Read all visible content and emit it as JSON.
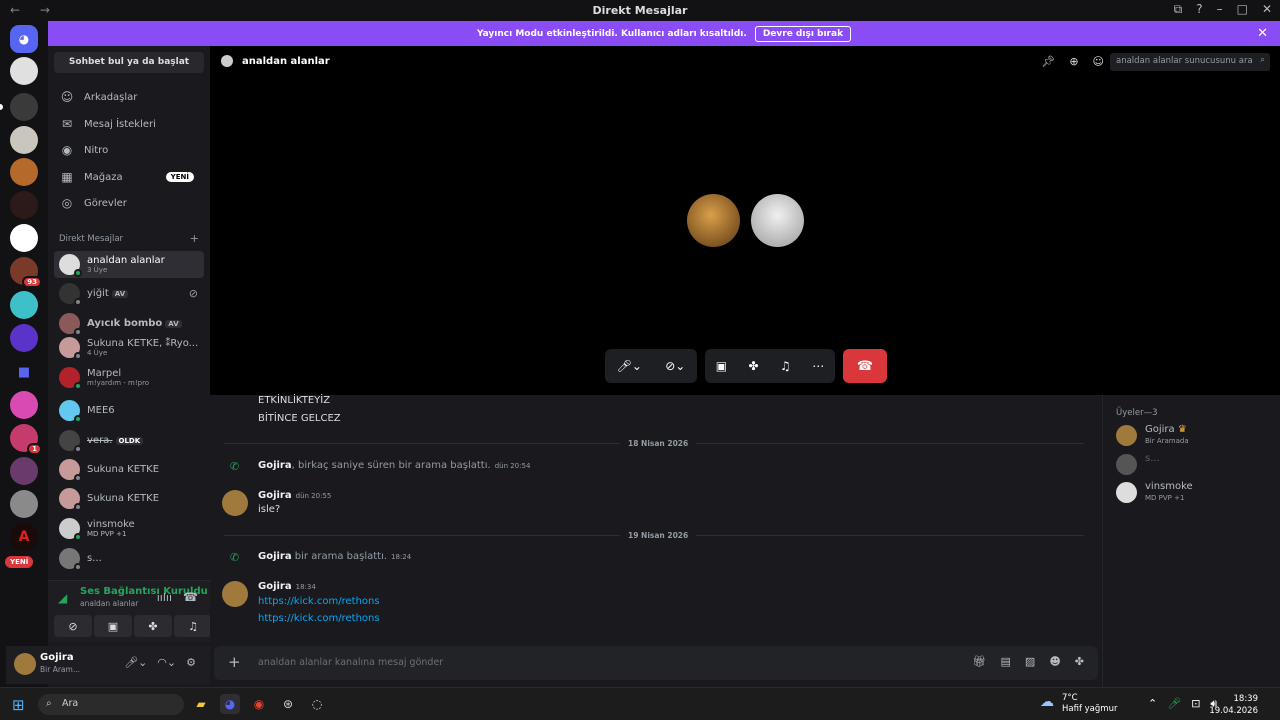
{
  "window": {
    "title": "Direkt Mesajlar",
    "nav": "← →",
    "controls": [
      "⧉",
      "?",
      "–",
      "□",
      "✕"
    ]
  },
  "banner": {
    "text": "Yayıncı Modu etkinleştirildi. Kullanıcı adları kısaltıldı.",
    "button": "Devre dışı bırak"
  },
  "guilds": {
    "badges": {
      "b93": "93",
      "b1": "1"
    },
    "new_label": "YENİ"
  },
  "sidebar": {
    "search": "Sohbet bul ya da başlat",
    "nav": [
      {
        "label": "Arkadaşlar",
        "icon": "friends-icon",
        "glyph": "☺"
      },
      {
        "label": "Mesaj İstekleri",
        "icon": "mail-icon",
        "glyph": "✉"
      },
      {
        "label": "Nitro",
        "icon": "nitro-icon",
        "glyph": "◉"
      },
      {
        "label": "Mağaza",
        "icon": "shop-icon",
        "glyph": "▦"
      },
      {
        "label": "Görevler",
        "icon": "quests-icon",
        "glyph": "◎"
      }
    ],
    "new_badge": "YENİ",
    "dm_header": "Direkt Mesajlar",
    "dm_plus": "+",
    "dms": [
      {
        "name": "analdan alanlar",
        "sub": "3 Üye"
      },
      {
        "name": "yiğit",
        "tag": "AV"
      },
      {
        "name": "Ayıcık bombo",
        "tag": "AV"
      },
      {
        "name": "Sukuna KETKE, ⁑Ryo...",
        "sub": "4 Üye"
      },
      {
        "name": "Marpel",
        "sub": "m!yardım - m!pro"
      },
      {
        "name": "MEE6"
      },
      {
        "name": "vera.",
        "tag": "OLDK"
      },
      {
        "name": "Sukuna KETKE"
      },
      {
        "name": "Sukuna KETKE"
      },
      {
        "name": "vinsmoke",
        "sub": "MD PVP +1"
      },
      {
        "name": "s..."
      }
    ]
  },
  "voice": {
    "status": "Ses Bağlantısı Kuruldu",
    "channel": "analdan alanlar"
  },
  "user": {
    "name": "Gojira",
    "status": "Bir Aram..."
  },
  "call": {
    "title": "analdan alanlar",
    "search_placeholder": "analdan alanlar sunucusunu ara"
  },
  "chat": {
    "lines": [
      "ETKİNLİKTEYİZ",
      "BİTİNCE GELCEZ"
    ],
    "dividers": [
      "18 Nisan 2026",
      "19 Nisan 2026"
    ],
    "sys1": {
      "author": "Gojira",
      "text": ", birkaç saniye süren bir arama başlattı.",
      "time": "dün 20:54"
    },
    "msg1": {
      "author": "Gojira",
      "time": "dün 20:55",
      "text": "isle?"
    },
    "sys2": {
      "author": "Gojira",
      "text": " bir arama başlattı.",
      "time": "18:24"
    },
    "msg2": {
      "author": "Gojira",
      "time": "18:34",
      "links": [
        "https://kick.com/rethons",
        "https://kick.com/rethons"
      ]
    },
    "composer_placeholder": "analdan alanlar kanalına mesaj gönder"
  },
  "members": {
    "header": "Üyeler—3",
    "list": [
      {
        "name": "Gojira",
        "crown": "♛",
        "status": "Bir Aramada"
      },
      {
        "name": "s..."
      },
      {
        "name": "vinsmoke",
        "status": "MD PVP +1"
      }
    ]
  },
  "taskbar": {
    "search": "Ara",
    "weather_temp": "7°C",
    "weather_desc": "Hafif yağmur",
    "time": "18:39",
    "date": "19.04.2026"
  },
  "colors": {
    "accent": "#8a4cf5",
    "danger": "#da373c",
    "online": "#23a55a",
    "link": "#00a8fc"
  }
}
